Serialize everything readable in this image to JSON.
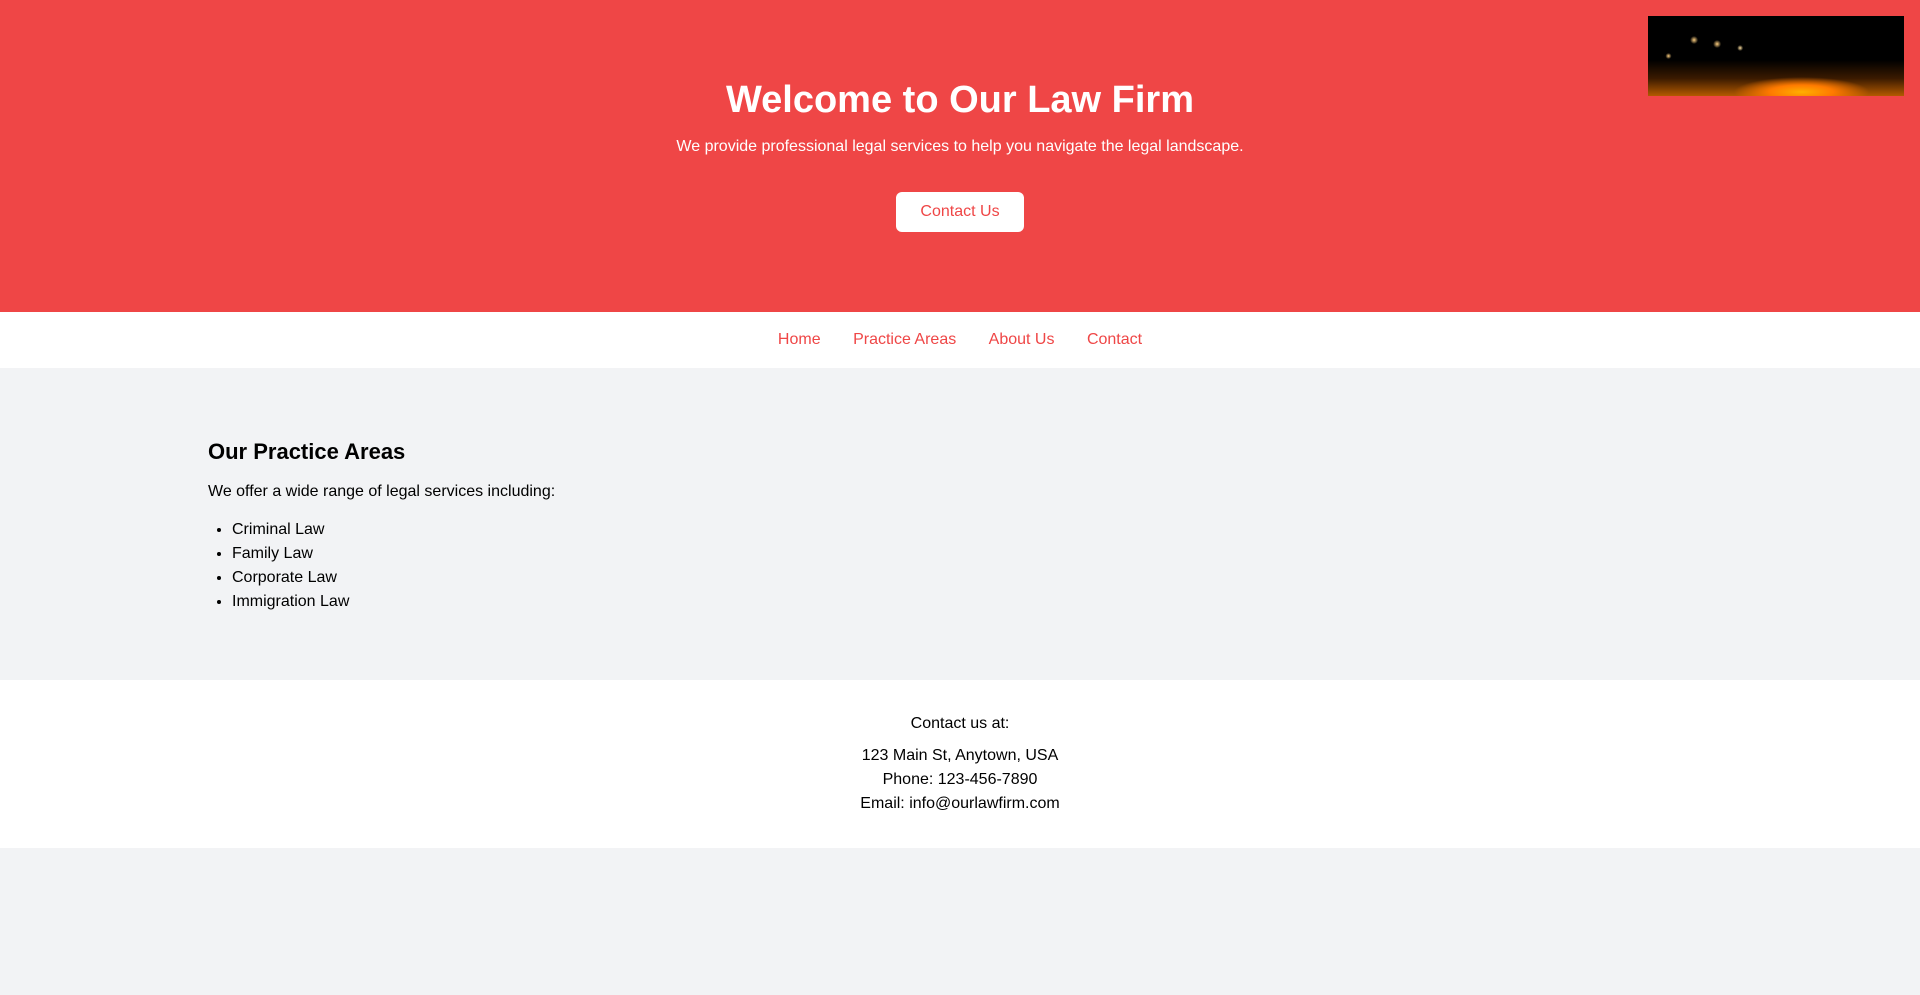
{
  "hero": {
    "title": "Welcome to Our Law Firm",
    "subtitle": "We provide professional legal services to help you navigate the legal landscape.",
    "cta_label": "Contact Us",
    "photo": "night-road-photo"
  },
  "nav": {
    "items": [
      {
        "label": "Home"
      },
      {
        "label": "Practice Areas"
      },
      {
        "label": "About Us"
      },
      {
        "label": "Contact"
      }
    ]
  },
  "practice": {
    "heading": "Our Practice Areas",
    "intro": "We offer a wide range of legal services including:",
    "items": [
      "Criminal Law",
      "Family Law",
      "Corporate Law",
      "Immigration Law"
    ]
  },
  "footer": {
    "lead": "Contact us at:",
    "address": "123 Main St, Anytown, USA",
    "phone": "Phone: 123-456-7890",
    "email": "Email: info@ourlawfirm.com"
  },
  "colors": {
    "brand": "#ef4646",
    "page_bg": "#f2f3f5",
    "surface": "#ffffff"
  }
}
